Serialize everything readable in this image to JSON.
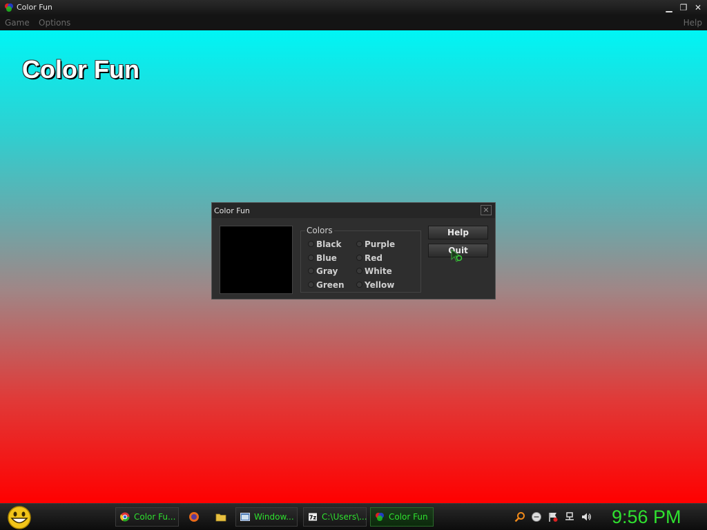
{
  "window": {
    "title": "Color Fun",
    "minimize_glyph": "▁",
    "maximize_glyph": "❐",
    "close_glyph": "✕"
  },
  "menu": {
    "game": "Game",
    "options": "Options",
    "help": "Help"
  },
  "canvas": {
    "heading": "Color Fun",
    "gradient_top": "#00f5f5",
    "gradient_bottom": "#ff0000"
  },
  "dialog": {
    "title": "Color Fun",
    "close_glyph": "✕",
    "swatch_color": "#000000",
    "group_label": "Colors",
    "colors": [
      "Black",
      "Blue",
      "Gray",
      "Green",
      "Purple",
      "Red",
      "White",
      "Yellow"
    ],
    "help_button": "Help",
    "quit_button": "Quit"
  },
  "taskbar": {
    "tasks": [
      {
        "label": "Color Fu...",
        "icon": "chrome-icon"
      },
      {
        "label": "Window...",
        "icon": "window-icon"
      },
      {
        "label": "C:\\Users\\...",
        "icon": "7zip-icon"
      },
      {
        "label": "Color Fun",
        "icon": "color-fun-icon"
      }
    ],
    "quick_launch": [
      "firefox-icon",
      "folder-icon"
    ],
    "tray": [
      "search-icon",
      "chat-icon",
      "flag-icon",
      "network-icon",
      "volume-icon"
    ],
    "clock": "9:56 PM",
    "accent_color": "#2fe02f"
  }
}
